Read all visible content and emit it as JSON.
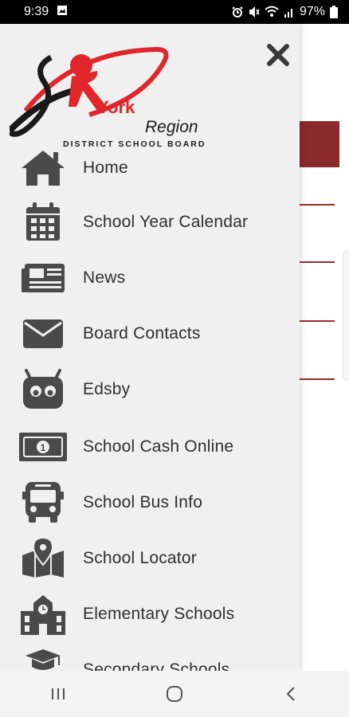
{
  "status": {
    "time": "9:39",
    "battery": "97%",
    "icons": [
      "image-icon",
      "alarm-icon",
      "mute-icon",
      "wifi-icon",
      "signal-icon",
      "battery-icon"
    ]
  },
  "logo": {
    "line1": "York",
    "line2": "Region",
    "line3": "DISTRICT SCHOOL BOARD",
    "colors": {
      "red": "#e0262b",
      "black": "#1a1a1a"
    }
  },
  "drawer": {
    "close_icon": "close-icon",
    "items": [
      {
        "label": "Home",
        "icon": "home-icon"
      },
      {
        "label": "School Year Calendar",
        "icon": "calendar-icon"
      },
      {
        "label": "News",
        "icon": "newspaper-icon"
      },
      {
        "label": "Board Contacts",
        "icon": "envelope-icon"
      },
      {
        "label": "Edsby",
        "icon": "edsby-robot-icon"
      },
      {
        "label": "School Cash Online",
        "icon": "money-bill-icon"
      },
      {
        "label": "School Bus Info",
        "icon": "bus-icon"
      },
      {
        "label": "School Locator",
        "icon": "map-marker-icon"
      },
      {
        "label": "Elementary Schools",
        "icon": "school-building-icon"
      },
      {
        "label": "Secondary Schools",
        "icon": "graduation-cap-icon"
      }
    ]
  },
  "navbar": {
    "icons": [
      "recent-apps-icon",
      "home-circle-icon",
      "back-icon"
    ]
  },
  "colors": {
    "icon": "#4a4a4a",
    "accent": "#8b2a2a",
    "drawer_bg": "#f0f0f0"
  }
}
